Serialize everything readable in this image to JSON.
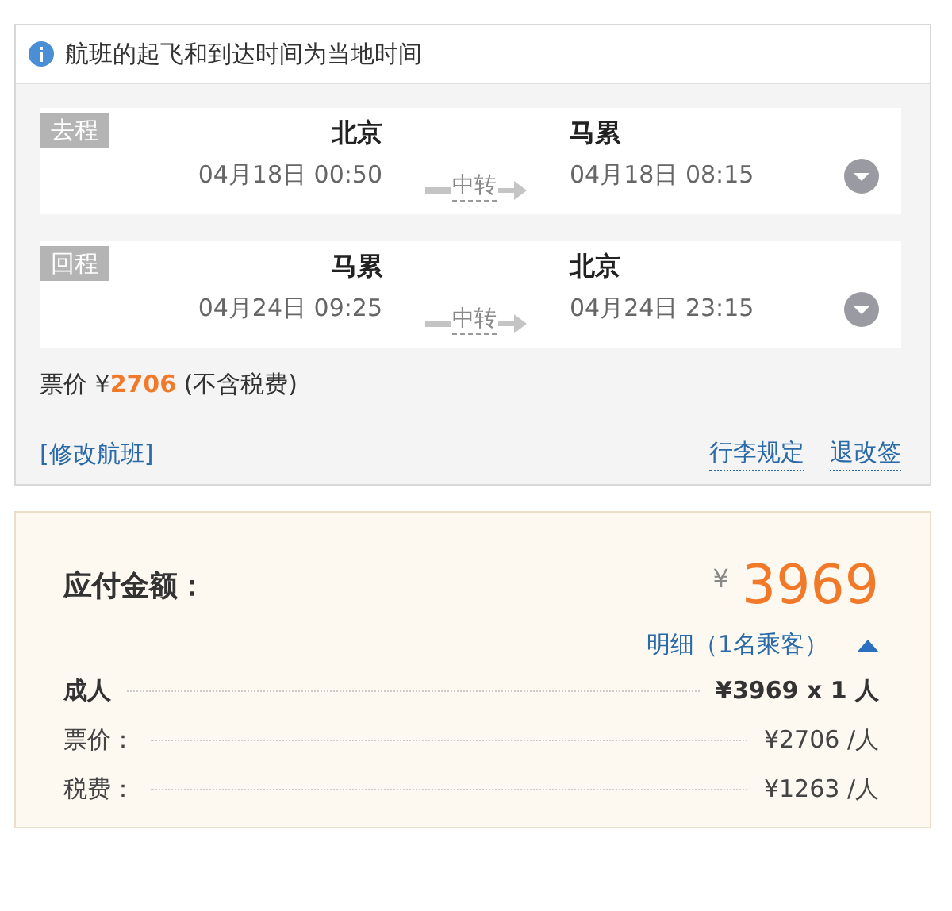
{
  "notice": "航班的起飞和到达时间为当地时间",
  "segments": [
    {
      "tag": "去程",
      "from": "北京",
      "depart": "04月18日 00:50",
      "via": "中转",
      "to": "马累",
      "arrive": "04月18日 08:15",
      "expanded": false
    },
    {
      "tag": "回程",
      "from": "马累",
      "depart": "04月24日 09:25",
      "via": "中转",
      "to": "北京",
      "arrive": "04月24日 23:15",
      "expanded": false
    }
  ],
  "fare": "票价 ¥**2706** (不含税费)",
  "links": {
    "modify": "[修改航班]",
    "baggage": "行李规定",
    "refund": "退改签"
  },
  "total": {
    "label": "应付金额：",
    "currency": "¥",
    "amount": "3969"
  },
  "detail": {
    "label": "明细（1名乘客）",
    "expanded": true
  },
  "breakdown": [
    {
      "kind": "head",
      "label": "成人",
      "value": "¥3969 x 1 人"
    },
    {
      "kind": "item",
      "label": "票价：",
      "value": "¥2706 /人"
    },
    {
      "kind": "item",
      "label": "税费：",
      "value": "¥1263 /人"
    }
  ]
}
